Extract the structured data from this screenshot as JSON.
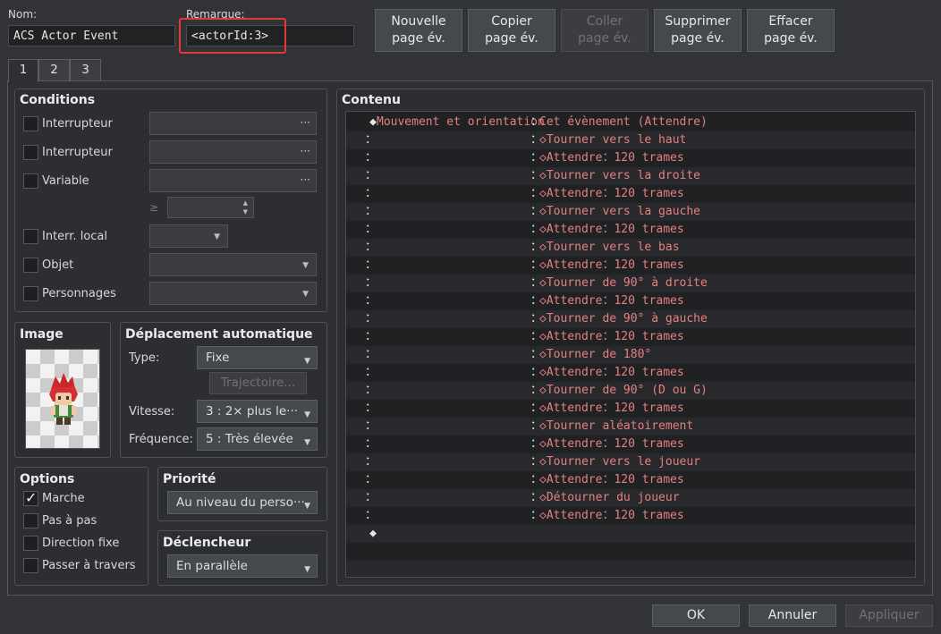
{
  "header": {
    "name_label": "Nom:",
    "name_value": "ACS Actor Event",
    "remark_label": "Remarque:",
    "remark_value": "<actorId:3>"
  },
  "toolbar": {
    "new_page": [
      "Nouvelle",
      "page év."
    ],
    "copy_page": [
      "Copier",
      "page év."
    ],
    "paste_page": [
      "Coller",
      "page év."
    ],
    "delete_page": [
      "Supprimer",
      "page év."
    ],
    "clear_page": [
      "Effacer",
      "page év."
    ]
  },
  "tabs": [
    "1",
    "2",
    "3"
  ],
  "conditions": {
    "title": "Conditions",
    "switch1": "Interrupteur",
    "switch2": "Interrupteur",
    "variable": "Variable",
    "ge": "≥",
    "self_switch": "Interr. local",
    "item": "Objet",
    "actor": "Personnages",
    "dots": "···"
  },
  "image": {
    "title": "Image"
  },
  "autonomous": {
    "title": "Déplacement automatique",
    "type_label": "Type:",
    "type_value": "Fixe",
    "route_button": "Trajectoire...",
    "speed_label": "Vitesse:",
    "speed_value": "3 : 2× plus le···",
    "freq_label": "Fréquence:",
    "freq_value": "5 : Très élevée"
  },
  "options": {
    "title": "Options",
    "walking": "Marche",
    "stepping": "Pas à pas",
    "direction_fix": "Direction fixe",
    "through": "Passer à travers",
    "walking_checked": true
  },
  "priority": {
    "title": "Priorité",
    "value": "Au niveau du perso···"
  },
  "trigger": {
    "title": "Déclencheur",
    "value": "En parallèle"
  },
  "contents": {
    "title": "Contenu",
    "rows": [
      {
        "prefix": "◆",
        "cmd": "Mouvement et orientation",
        "sep": "：",
        "text": "Cet évènement (Attendre)"
      },
      {
        "prefix": "：",
        "cmd": "",
        "sep": "：",
        "text": "◇Tourner vers le haut"
      },
      {
        "prefix": "：",
        "cmd": "",
        "sep": "：",
        "text": "◇Attendre：120 trames"
      },
      {
        "prefix": "：",
        "cmd": "",
        "sep": "：",
        "text": "◇Tourner vers la droite"
      },
      {
        "prefix": "：",
        "cmd": "",
        "sep": "：",
        "text": "◇Attendre：120 trames"
      },
      {
        "prefix": "：",
        "cmd": "",
        "sep": "：",
        "text": "◇Tourner vers la gauche"
      },
      {
        "prefix": "：",
        "cmd": "",
        "sep": "：",
        "text": "◇Attendre：120 trames"
      },
      {
        "prefix": "：",
        "cmd": "",
        "sep": "：",
        "text": "◇Tourner vers le bas"
      },
      {
        "prefix": "：",
        "cmd": "",
        "sep": "：",
        "text": "◇Attendre：120 trames"
      },
      {
        "prefix": "：",
        "cmd": "",
        "sep": "：",
        "text": "◇Tourner de 90° à droite"
      },
      {
        "prefix": "：",
        "cmd": "",
        "sep": "：",
        "text": "◇Attendre：120 trames"
      },
      {
        "prefix": "：",
        "cmd": "",
        "sep": "：",
        "text": "◇Tourner de 90° à gauche"
      },
      {
        "prefix": "：",
        "cmd": "",
        "sep": "：",
        "text": "◇Attendre：120 trames"
      },
      {
        "prefix": "：",
        "cmd": "",
        "sep": "：",
        "text": "◇Tourner de 180°"
      },
      {
        "prefix": "：",
        "cmd": "",
        "sep": "：",
        "text": "◇Attendre：120 trames"
      },
      {
        "prefix": "：",
        "cmd": "",
        "sep": "：",
        "text": "◇Tourner de 90° (D ou G)"
      },
      {
        "prefix": "：",
        "cmd": "",
        "sep": "：",
        "text": "◇Attendre：120 trames"
      },
      {
        "prefix": "：",
        "cmd": "",
        "sep": "：",
        "text": "◇Tourner aléatoirement"
      },
      {
        "prefix": "：",
        "cmd": "",
        "sep": "：",
        "text": "◇Attendre：120 trames"
      },
      {
        "prefix": "：",
        "cmd": "",
        "sep": "：",
        "text": "◇Tourner vers le joueur"
      },
      {
        "prefix": "：",
        "cmd": "",
        "sep": "：",
        "text": "◇Attendre：120 trames"
      },
      {
        "prefix": "：",
        "cmd": "",
        "sep": "：",
        "text": "◇Détourner du joueur"
      },
      {
        "prefix": "：",
        "cmd": "",
        "sep": "：",
        "text": "◇Attendre：120 trames"
      },
      {
        "prefix": "◆",
        "cmd": "",
        "sep": "",
        "text": ""
      }
    ]
  },
  "footer": {
    "ok": "OK",
    "cancel": "Annuler",
    "apply": "Appliquer"
  },
  "colors": {
    "highlight": "#e23a3a",
    "command": "#e48080"
  }
}
